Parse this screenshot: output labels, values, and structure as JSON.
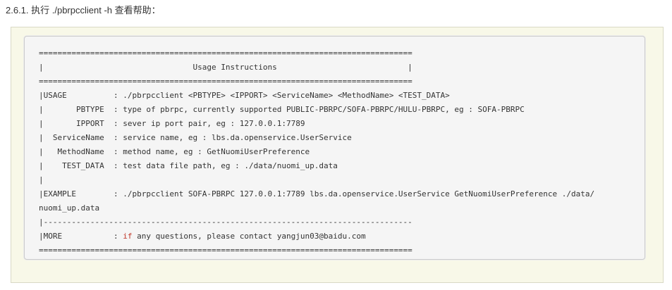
{
  "heading": "2.6.1. 执行 ./pbrpcclient -h 查看帮助：",
  "colors": {
    "frame_background": "#f8f8e8",
    "code_background": "#f5f5f5",
    "keyword": "#c0392b",
    "text": "#333333"
  },
  "code": {
    "separator": "================================================================================",
    "title_row": "|                                Usage Instructions                            |",
    "usage_row": "|USAGE          : ./pbrpcclient <PBTYPE> <IPPORT> <ServiceName> <MethodName> <TEST_DATA>",
    "pbtype_row": "|       PBTYPE  : type of pbrpc, currently supported PUBLIC-PBRPC/SOFA-PBRPC/HULU-PBRPC, eg : SOFA-PBRPC",
    "ipport_row": "|       IPPORT  : sever ip port pair, eg : 127.0.0.1:7789",
    "servicename_row": "|  ServiceName  : service name, eg : lbs.da.openservice.UserService",
    "methodname_row": "|   MethodName  : method name, eg : GetNuomiUserPreference",
    "testdata_row": "|    TEST_DATA  : test data file path, eg : ./data/nuomi_up.data",
    "empty_row": "|",
    "example_row": "|EXAMPLE        : ./pbrpcclient SOFA-PBRPC 127.0.0.1:7789 lbs.da.openservice.UserService GetNuomiUserPreference ./data/",
    "example_cont_row": "nuomi_up.data",
    "dash_separator": "|-------------------------------------------------------------------------------",
    "more_prefix": "|MORE           : ",
    "more_keyword": "if",
    "more_suffix": " any questions, please contact yangjun03@baidu.com"
  }
}
